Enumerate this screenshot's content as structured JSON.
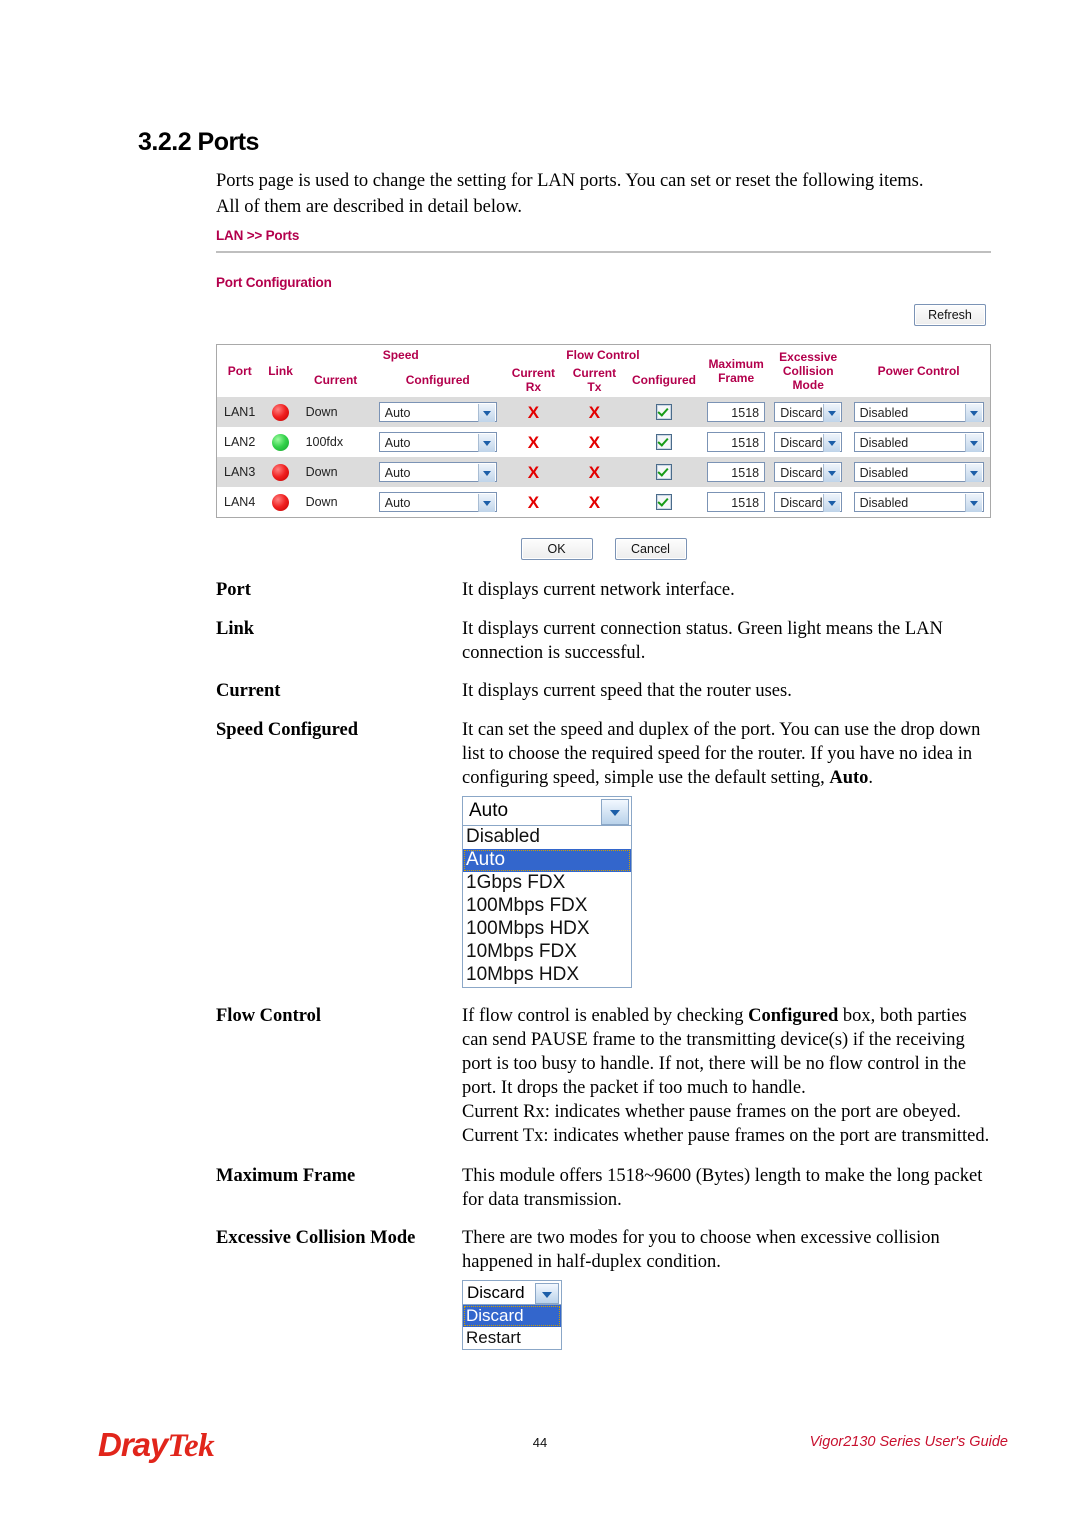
{
  "section": {
    "heading": "3.2.2 Ports",
    "intro": "Ports page is used to change the setting for LAN ports. You can set or reset the following items. All of them are described in detail below."
  },
  "panel": {
    "breadcrumb": "LAN >> Ports",
    "subtitle": "Port Configuration",
    "refresh_label": "Refresh",
    "ok_label": "OK",
    "cancel_label": "Cancel",
    "accent_color": "#b3004c"
  },
  "table": {
    "group_headers": {
      "speed": "Speed",
      "flow_control": "Flow Control"
    },
    "headers": {
      "port": "Port",
      "link": "Link",
      "speed_current": "Current",
      "speed_configured": "Configured",
      "fc_current_rx": "Current Rx",
      "fc_current_tx": "Current Tx",
      "fc_configured": "Configured",
      "maximum_frame": "Maximum Frame",
      "excessive_collision_mode": "Excessive Collision Mode",
      "power_control": "Power Control"
    },
    "rows": [
      {
        "port": "LAN1",
        "link_state": "red",
        "speed_current": "Down",
        "speed_configured": "Auto",
        "fc_current_rx": "X",
        "fc_current_tx": "X",
        "fc_configured_checked": true,
        "maximum_frame": "1518",
        "excessive_collision_mode": "Discard",
        "power_control": "Disabled"
      },
      {
        "port": "LAN2",
        "link_state": "green",
        "speed_current": "100fdx",
        "speed_configured": "Auto",
        "fc_current_rx": "X",
        "fc_current_tx": "X",
        "fc_configured_checked": true,
        "maximum_frame": "1518",
        "excessive_collision_mode": "Discard",
        "power_control": "Disabled"
      },
      {
        "port": "LAN3",
        "link_state": "red",
        "speed_current": "Down",
        "speed_configured": "Auto",
        "fc_current_rx": "X",
        "fc_current_tx": "X",
        "fc_configured_checked": true,
        "maximum_frame": "1518",
        "excessive_collision_mode": "Discard",
        "power_control": "Disabled"
      },
      {
        "port": "LAN4",
        "link_state": "red",
        "speed_current": "Down",
        "speed_configured": "Auto",
        "fc_current_rx": "X",
        "fc_current_tx": "X",
        "fc_configured_checked": true,
        "maximum_frame": "1518",
        "excessive_collision_mode": "Discard",
        "power_control": "Disabled"
      }
    ]
  },
  "definitions": [
    {
      "term": "Port",
      "desc": "It displays current network interface."
    },
    {
      "term": "Link",
      "desc": "It displays current connection status. Green light means the LAN connection is successful."
    },
    {
      "term": "Current",
      "desc": "It displays current speed that the router uses."
    },
    {
      "term": "Speed Configured",
      "desc_part1": "It can set the speed and duplex of the port. You can use the drop down list to choose the required speed for the router. If you have no idea in configuring speed, simple use the default setting, ",
      "desc_bold": "Auto",
      "desc_part2": "."
    },
    {
      "term": "Flow Control",
      "desc_part1": "If flow control is enabled by checking ",
      "desc_bold": "Configured",
      "desc_part2": " box, both parties can send PAUSE frame to the transmitting device(s) if the receiving port is too busy to handle. If not, there will be no flow control in the port. It drops the packet if too much to handle.",
      "desc_line2": "Current Rx: indicates whether pause frames on the port are obeyed.",
      "desc_line3": "Current Tx: indicates whether pause frames on the port are transmitted."
    },
    {
      "term": "Maximum Frame",
      "desc": "This module offers 1518~9600 (Bytes) length to make the long packet for data transmission."
    },
    {
      "term": "Excessive Collision Mode",
      "desc": "There are two modes for you to choose when excessive collision happened in half-duplex condition."
    }
  ],
  "speed_dropdown": {
    "selected": "Auto",
    "options": [
      "Disabled",
      "Auto",
      "1Gbps FDX",
      "100Mbps FDX",
      "100Mbps HDX",
      "10Mbps FDX",
      "10Mbps HDX"
    ],
    "highlighted": "Auto"
  },
  "collision_dropdown": {
    "selected": "Discard",
    "options": [
      "Discard",
      "Restart"
    ],
    "highlighted": "Discard"
  },
  "footer": {
    "logo_part1": "Dray",
    "logo_part2": "Tek",
    "page_number": "44",
    "guide_title": "Vigor2130 Series User's Guide",
    "logo_color": "#e1251b"
  }
}
